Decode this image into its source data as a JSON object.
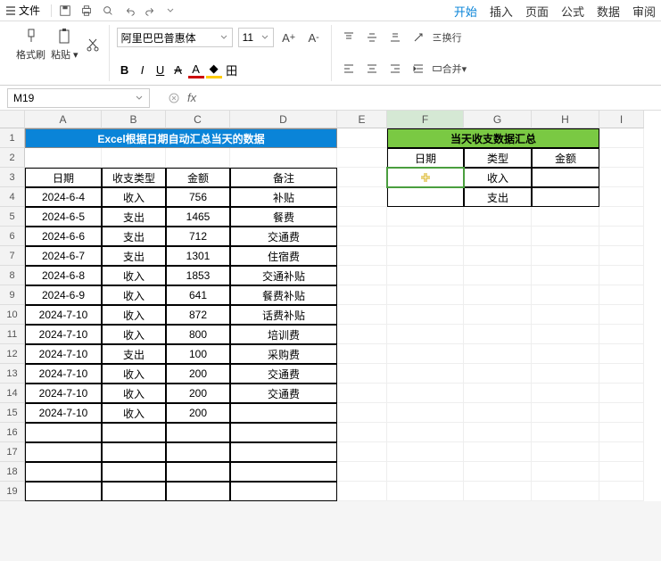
{
  "menu": {
    "file": "文件"
  },
  "tabs": [
    "开始",
    "插入",
    "页面",
    "公式",
    "数据",
    "审阅"
  ],
  "activeTab": 0,
  "ribbon": {
    "formatBrush": "格式刷",
    "paste": "粘贴",
    "fontName": "阿里巴巴普惠体",
    "fontSize": "11",
    "wrap": "换行",
    "merge": "合并"
  },
  "nameBox": "M19",
  "fxLabel": "fx",
  "cols": [
    "A",
    "B",
    "C",
    "D",
    "E",
    "F",
    "G",
    "H",
    "I"
  ],
  "leftTitle": "Excel根据日期自动汇总当天的数据",
  "leftHeaders": [
    "日期",
    "收支类型",
    "金额",
    "备注"
  ],
  "rows": [
    [
      "2024-6-4",
      "收入",
      "756",
      "补贴"
    ],
    [
      "2024-6-5",
      "支出",
      "1465",
      "餐费"
    ],
    [
      "2024-6-6",
      "支出",
      "712",
      "交通费"
    ],
    [
      "2024-6-7",
      "支出",
      "1301",
      "住宿费"
    ],
    [
      "2024-6-8",
      "收入",
      "1853",
      "交通补贴"
    ],
    [
      "2024-6-9",
      "收入",
      "641",
      "餐费补贴"
    ],
    [
      "2024-7-10",
      "收入",
      "872",
      "话费补贴"
    ],
    [
      "2024-7-10",
      "收入",
      "800",
      "培训费"
    ],
    [
      "2024-7-10",
      "支出",
      "100",
      "采购费"
    ],
    [
      "2024-7-10",
      "收入",
      "200",
      "交通费"
    ],
    [
      "2024-7-10",
      "收入",
      "200",
      "交通费"
    ],
    [
      "2024-7-10",
      "收入",
      "200",
      ""
    ]
  ],
  "rightTitle": "当天收支数据汇总",
  "rightHeaders": [
    "日期",
    "类型",
    "金额"
  ],
  "rightRows": [
    [
      "",
      "收入",
      ""
    ],
    [
      "",
      "支出",
      ""
    ]
  ]
}
